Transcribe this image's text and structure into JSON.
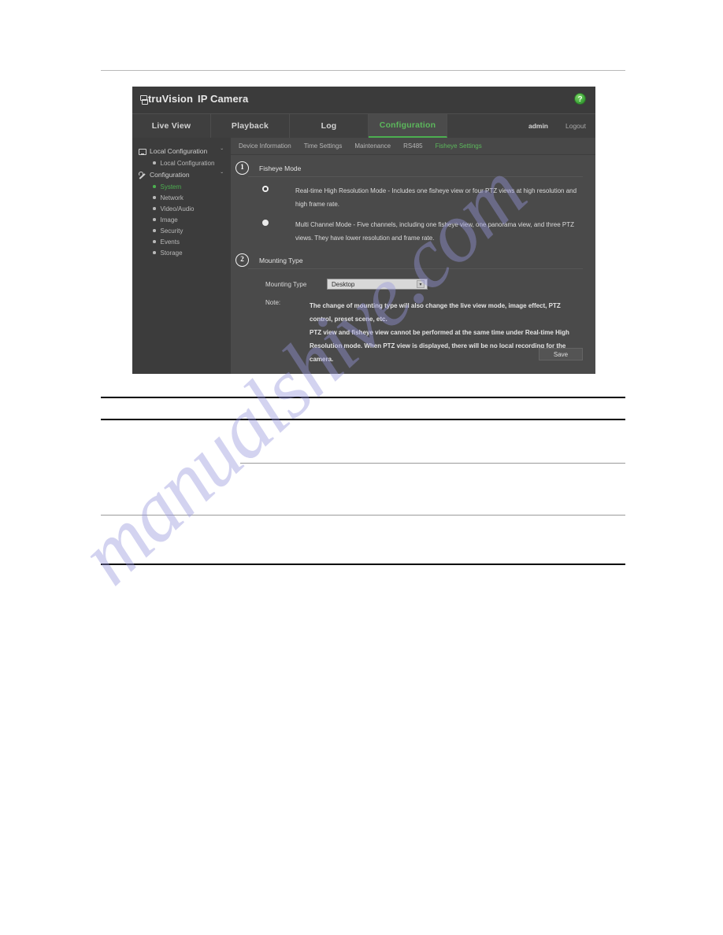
{
  "screenshot": {
    "header": {
      "logo_prefix": "truVision",
      "logo_suffix": "IP Camera",
      "help_icon": "help-icon",
      "help_glyph": "?"
    },
    "tabs": [
      {
        "label": "Live View",
        "active": false
      },
      {
        "label": "Playback",
        "active": false
      },
      {
        "label": "Log",
        "active": false
      },
      {
        "label": "Configuration",
        "active": true
      }
    ],
    "user": {
      "name": "admin",
      "logout": "Logout"
    },
    "subtabs": [
      {
        "label": "Device Information",
        "active": false
      },
      {
        "label": "Time Settings",
        "active": false
      },
      {
        "label": "Maintenance",
        "active": false
      },
      {
        "label": "RS485",
        "active": false
      },
      {
        "label": "Fisheye Settings",
        "active": true
      }
    ],
    "sidebar": {
      "groups": [
        {
          "label": "Local Configuration",
          "icon": "monitor-icon",
          "caret": "ˇ",
          "items": [
            {
              "label": "Local Configuration",
              "active": false
            }
          ]
        },
        {
          "label": "Configuration",
          "icon": "wrench-icon",
          "caret": "ˇ",
          "items": [
            {
              "label": "System",
              "active": true
            },
            {
              "label": "Network",
              "active": false
            },
            {
              "label": "Video/Audio",
              "active": false
            },
            {
              "label": "Image",
              "active": false
            },
            {
              "label": "Security",
              "active": false
            },
            {
              "label": "Events",
              "active": false
            },
            {
              "label": "Storage",
              "active": false
            }
          ]
        }
      ]
    },
    "sections": {
      "fisheye_mode": {
        "marker": "1",
        "title": "Fisheye Mode",
        "options": [
          {
            "selected": true,
            "label": "Real-time High Resolution Mode - Includes one fisheye view or four PTZ views at high resolution and high frame rate."
          },
          {
            "selected": false,
            "label": "Multi Channel Mode - Five channels, including one fisheye view, one panorama view, and three PTZ views. They have lower resolution and frame rate."
          }
        ]
      },
      "mounting_type": {
        "marker": "2",
        "title": "Mounting Type",
        "field_label": "Mounting Type",
        "selected_value": "Desktop",
        "arrow_glyph": "▾",
        "note_label": "Note:",
        "note_lines": [
          "The change of mounting type will also change the live view mode, image effect, PTZ control, preset scene, etc.",
          "PTZ view and fisheye view cannot be performed at the same time under Real-time High Resolution mode. When PTZ view is displayed, there will be no local recording for the camera."
        ]
      }
    },
    "save_label": "Save"
  },
  "watermark": {
    "text": "manualshive.com"
  },
  "colors": {
    "accent_green": "#4caf50",
    "panel_bg": "#4a4a4a",
    "sidebar_bg": "#3c3c3c",
    "header_bg": "#3b3b3b"
  }
}
